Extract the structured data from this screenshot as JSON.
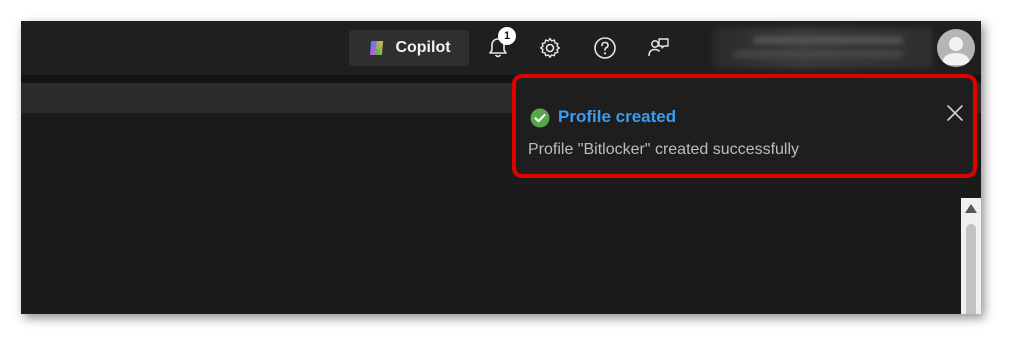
{
  "header": {
    "copilot_label": "Copilot",
    "notification_count": "1",
    "icons": [
      "bell-icon",
      "gear-icon",
      "help-icon",
      "feedback-icon"
    ]
  },
  "toast": {
    "title": "Profile created",
    "message": "Profile \"Bitlocker\" created successfully",
    "status": "success",
    "highlight_color": "#e00000",
    "title_color": "#3b9cf0",
    "check_color": "#57a64a"
  }
}
